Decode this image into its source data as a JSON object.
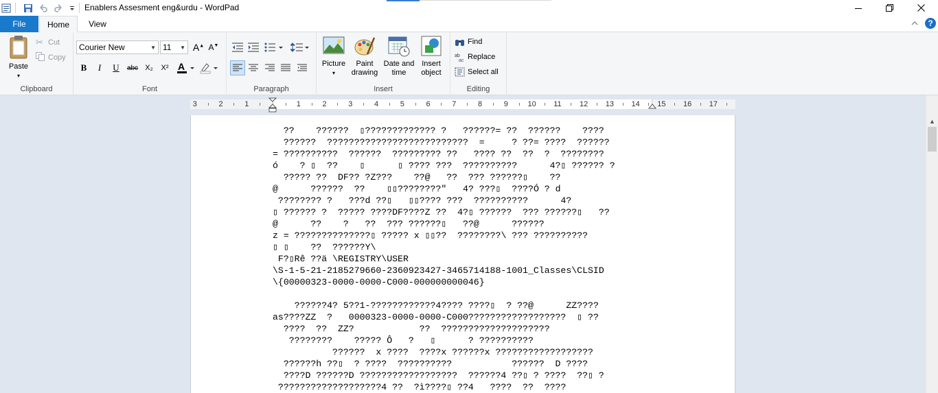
{
  "window": {
    "title": "Enablers Assesment eng&urdu - WordPad",
    "controls": {
      "minimize": "—",
      "restore": "❐",
      "close": "✕"
    }
  },
  "tabs": {
    "file": "File",
    "home": "Home",
    "view": "View"
  },
  "ribbon": {
    "clipboard": {
      "label": "Clipboard",
      "paste": "Paste",
      "cut": "Cut",
      "copy": "Copy"
    },
    "font": {
      "label": "Font",
      "family": "Courier New",
      "size": "11",
      "bold": "B",
      "italic": "I",
      "underline": "U",
      "strike": "abc",
      "subscript": "X₂",
      "superscript": "X²"
    },
    "paragraph": {
      "label": "Paragraph"
    },
    "insert": {
      "label": "Insert",
      "picture": "Picture",
      "paint_line1": "Paint",
      "paint_line2": "drawing",
      "datetime_line1": "Date and",
      "datetime_line2": "time",
      "object_line1": "Insert",
      "object_line2": "object"
    },
    "editing": {
      "label": "Editing",
      "find": "Find",
      "replace": "Replace",
      "select_all": "Select all"
    }
  },
  "ruler": {
    "numbers": [
      "3",
      "2",
      "1",
      "1",
      "2",
      "3",
      "4",
      "5",
      "6",
      "7",
      "8",
      "9",
      "10",
      "11",
      "12",
      "13",
      "14",
      "15",
      "16",
      "17"
    ]
  },
  "document": {
    "lines": [
      "  ??    ??????  ▯????????????? ?   ??????= ??  ??????    ????",
      "  ??????  ??????????????????????????  =     ? ??= ????  ??????",
      "= ??????????  ??????  ????????? ??   ???? ??  ??  ?  ????????",
      "ó    ? ▯  ??    ▯      ▯ ???? ???  ??????????      4?▯ ?????? ?",
      "  ????? ??  DF?? ?Z???    ??@   ??  ??? ??????▯    ??",
      "@      ??????  ??    ▯▯????????\"   4? ???▯  ????Ó ? d",
      " ???????? ?   ???d ??▯   ▯▯???? ???  ??????????      4?",
      "▯ ?????? ?  ????? ????DF????Z ??  4?▯ ??????  ??? ??????▯   ??",
      "@      ??    ?   ??  ??? ??????▯   ??@      ??????",
      "z = ??????????????▯ ????? x ▯▯??  ????????\\ ??? ??????????",
      "▯ ▯    ??  ??????Y\\",
      " F?▯Rê ??ä \\REGISTRY\\USER",
      "\\S-1-5-21-2185279660-2360923427-3465714188-1001_Classes\\CLSID",
      "\\{00000323-0000-0000-C000-000000000046}",
      "",
      "    ??????4? 5??1-????????????4???? ????▯  ? ??@      ZZ????",
      "as????ZZ  ?   0000323-0000-0000-C000??????????????????  ▯ ??",
      "  ????  ??  ZZ?            ??  ????????????????????",
      "   ????????    ????? Ô   ?   ▯      ? ??????????",
      "           ??????  x ????  ????x ??????x ??????????????????",
      "  ??????h ??▯  ? ????  ??????????           ??????  D ????",
      "  ????D ??????D ??????????????????  ??????4 ??▯ ? ????  ??▯ ?",
      " ???????????????????4 ??  ?ì????▯ ??4   ????  ??  ????"
    ]
  }
}
